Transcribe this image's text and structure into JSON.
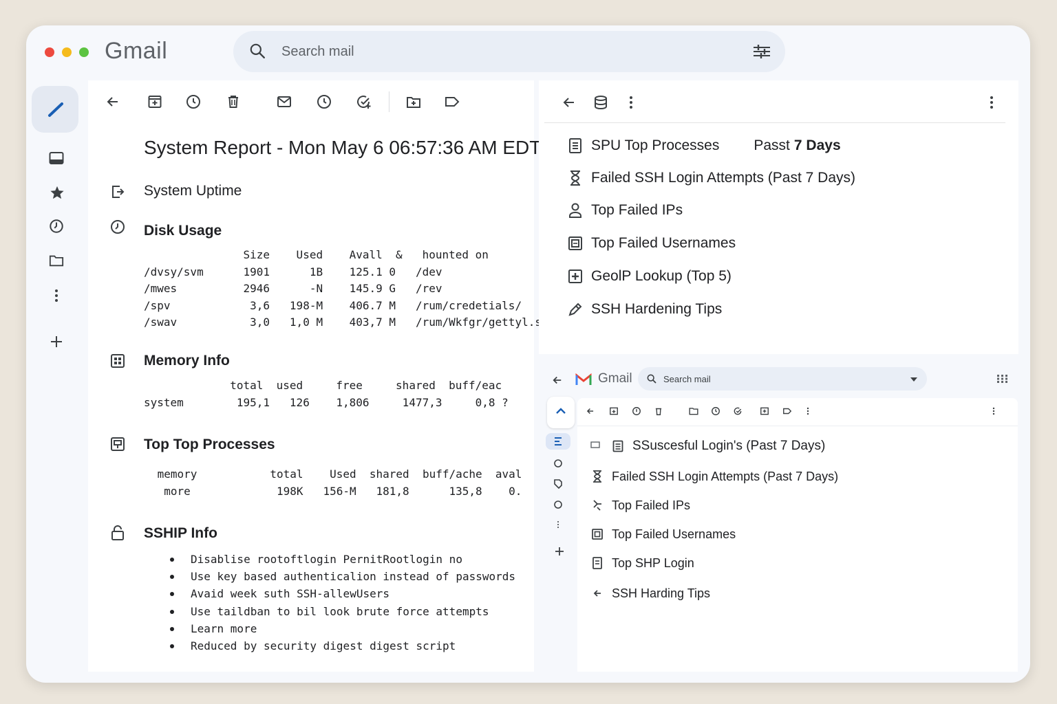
{
  "app": {
    "name": "Gmail",
    "search_placeholder": "Search mail"
  },
  "left_pane": {
    "subject": "System Report - Mon May 6 06:57:36 AM EDT",
    "uptime_label": "System Uptime",
    "disk": {
      "title": "Disk Usage",
      "table": "               Size    Used    Avall  &   hounted on\n/dvsy/svm      1901      1B    125.1 0   /dev\n/mwes          2946      -N    145.9 G   /rev\n/spv            3,6   198-M    406.7 M   /rum/credetials/\n/swav           3,0   1,0 M    403,7 M   /rum/Wkfgr/gettyl.s"
    },
    "memory": {
      "title": "Memory Info",
      "table": "             total  used     free     shared  buff/eac\nsystem        195,1   126    1,806     1477,3     0,8 ?"
    },
    "processes": {
      "title": "Top Top Processes",
      "table": " memory           total    Used  shared  buff/ache  aval\n  more             198K   156-M   181,8      135,8    0."
    },
    "sship": {
      "title": "SSHIP Info",
      "tips": [
        "Disablise rootoftlogin  PernitRootlogin no",
        "Use key based authenticalion instead of passwords",
        "Avaid week suth SSH-allewUsers",
        "Use taildban to bil look brute force attempts",
        "Learn more",
        "Reduced by security digest digest script"
      ]
    }
  },
  "right_top": {
    "items": [
      {
        "label": "SPU Top Processes",
        "extra": "Passt",
        "extra_bold": "7 Days",
        "icon": "document-icon"
      },
      {
        "label": "Failed SSH Login Attempts (Past 7 Days)",
        "icon": "hourglass-icon"
      },
      {
        "label": "Top Failed IPs",
        "icon": "person-icon"
      },
      {
        "label": "Top Failed Usernames",
        "icon": "square-list-icon"
      },
      {
        "label": "GeolP Lookup (Top 5)",
        "icon": "add-box-icon"
      },
      {
        "label": "SSH Hardening Tips",
        "icon": "pencil-icon"
      }
    ]
  },
  "right_bottom": {
    "app_name": "Gmail",
    "search_placeholder": "Search mail",
    "items": [
      {
        "label": "SSuscesful Login's (Past 7 Days)",
        "icon": "document-icon"
      },
      {
        "label": "Failed SSH Login Attempts (Past 7 Days)",
        "icon": "hourglass-icon"
      },
      {
        "label": "Top Failed IPs",
        "icon": "flow-icon"
      },
      {
        "label": "Top Failed Usernames",
        "icon": "square-list-icon"
      },
      {
        "label": "Top SHP Login",
        "icon": "document-icon"
      },
      {
        "label": "SSH Harding Tips",
        "icon": "arrow-left-icon"
      }
    ]
  },
  "colors": {
    "window_bg": "#f6f8fc",
    "compose_blue": "#1a5fb4",
    "search_bg": "#e9eef6",
    "gmail_red": "#ea4335"
  }
}
